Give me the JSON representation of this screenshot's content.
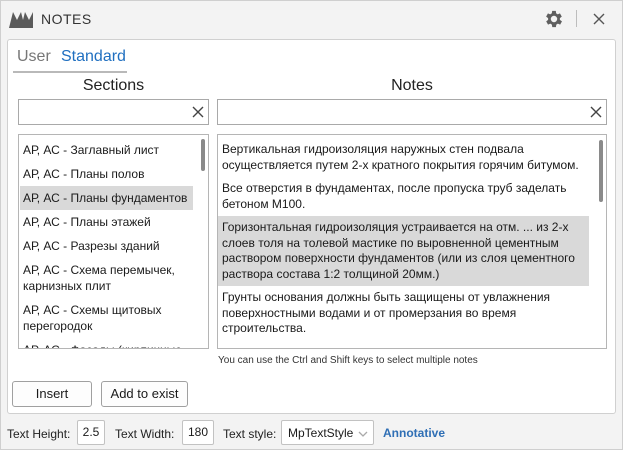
{
  "window": {
    "title": "NOTES"
  },
  "tabs": [
    {
      "label": "User",
      "active": false
    },
    {
      "label": "Standard",
      "active": true
    }
  ],
  "sections": {
    "title": "Sections",
    "search_value": "",
    "items": [
      {
        "label": "АР, АС - Заглавный лист",
        "selected": false
      },
      {
        "label": "АР, АС - Планы полов",
        "selected": false
      },
      {
        "label": "АР, АС - Планы фундаментов",
        "selected": true
      },
      {
        "label": "АР, АС - Планы этажей",
        "selected": false
      },
      {
        "label": "АР, АС - Разрезы зданий",
        "selected": false
      },
      {
        "label": "АР, АС - Схема перемычек, карнизных плит",
        "selected": false
      },
      {
        "label": "АР, АС - Схемы щитовых перегородок",
        "selected": false
      },
      {
        "label": "АР, АС - Фасады (кирпичные",
        "selected": false
      }
    ]
  },
  "notes": {
    "title": "Notes",
    "search_value": "",
    "items": [
      {
        "text": "Вертикальная гидроизоляция наружных стен подвала осуществляется путем 2-х кратного покрытия горячим битумом.",
        "selected": false
      },
      {
        "text": "Все отверстия в фундаментах, после пропуска труб заделать бетоном М100.",
        "selected": false
      },
      {
        "text": "Горизонтальная гидроизоляция устраивается на отм. ... из 2-х слоев толя на толевой мастике по выровненной цементным раствором поверхности фундаментов (или из слоя цементного раствора состава 1:2 толщиной 20мм.)",
        "selected": true
      },
      {
        "text": "Грунты основания должны быть защищены от увлажнения поверхностными водами и от промерзания во время строительства.",
        "selected": false
      }
    ],
    "hint": "You can use the Ctrl and Shift keys to select multiple notes"
  },
  "buttons": {
    "insert": "Insert",
    "add_to_exist": "Add to exist"
  },
  "bottom": {
    "text_height_label": "Text Height:",
    "text_height_value": "2.5",
    "text_width_label": "Text Width:",
    "text_width_value": "180",
    "text_style_label": "Text style:",
    "text_style_value": "MpTextStyle",
    "annotative_label": "Annotative"
  },
  "colors": {
    "accent": "#1f6fc0",
    "annotative": "#2f6fb5",
    "selection": "#d9d9d9"
  }
}
